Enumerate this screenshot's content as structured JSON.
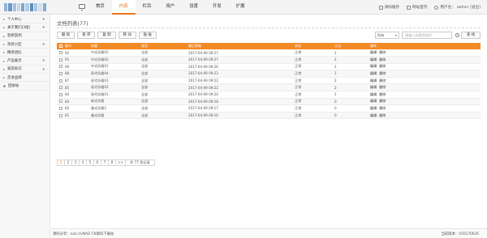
{
  "logo": {
    "colors": [
      "#8fb4d8",
      "#6b97c4",
      "#9fc1de",
      "#c6d8ea",
      "#7da6ce",
      "#b2cde5",
      "#5e8bba",
      "#a7c5e1",
      "#d0e1ef",
      "#84abd1"
    ]
  },
  "nav": {
    "items": [
      {
        "label": "首页",
        "active": false
      },
      {
        "label": "内容",
        "active": true
      },
      {
        "label": "栏目",
        "active": false
      },
      {
        "label": "用户",
        "active": false
      },
      {
        "label": "设置",
        "active": false
      },
      {
        "label": "开发",
        "active": false
      },
      {
        "label": "扩展",
        "active": false
      }
    ]
  },
  "toplinks": {
    "cache": "清除缓存",
    "home": "网站首页",
    "user_prefix": "用户名：",
    "username": "admin",
    "logout": "[退出]"
  },
  "sidebar": {
    "items": [
      {
        "label": "个人中心",
        "plus": true
      },
      {
        "label": "关于我们(3组)",
        "plus": true
      },
      {
        "label": "装修案例",
        "plus": false
      },
      {
        "label": "热装小区",
        "plus": true
      },
      {
        "label": "精英团队",
        "plus": false
      },
      {
        "label": "产品展示",
        "plus": true
      },
      {
        "label": "家装知识",
        "plus": true
      },
      {
        "label": "走进品牌",
        "plus": false
      },
      {
        "label": "回收站",
        "plus": false,
        "dot": true
      }
    ]
  },
  "page": {
    "title": "文档列表(77)"
  },
  "toolbar": {
    "buttons": [
      "删 除",
      "排 序",
      "复 制",
      "移 动",
      "粘 贴"
    ]
  },
  "filter": {
    "select": "所有",
    "placeholder": "请输入标题关键字",
    "search_label": "查 找"
  },
  "table": {
    "headers": [
      "",
      "编号",
      "标题",
      "类型",
      "最后更新",
      "状态",
      "点击",
      "操作"
    ],
    "rows": [
      {
        "id": "92",
        "title": "中式风格03",
        "type": "全部",
        "updated": "2017-04-09 09:27",
        "status": "正常",
        "clicks": "1"
      },
      {
        "id": "91",
        "title": "中式风格02",
        "type": "全部",
        "updated": "2017-04-09 09:27",
        "status": "正常",
        "clicks": "2"
      },
      {
        "id": "90",
        "title": "中式风格01",
        "type": "全部",
        "updated": "2017-04-09 09:26",
        "status": "正常",
        "clicks": "1"
      },
      {
        "id": "88",
        "title": "现代风格04",
        "type": "全部",
        "updated": "2017-04-09 09:23",
        "status": "正常",
        "clicks": "1"
      },
      {
        "id": "87",
        "title": "现代风格03",
        "type": "全部",
        "updated": "2017-04-09 09:22",
        "status": "正常",
        "clicks": "2"
      },
      {
        "id": "85",
        "title": "现代风格02",
        "type": "全部",
        "updated": "2017-04-09 09:22",
        "status": "正常",
        "clicks": "2"
      },
      {
        "id": "84",
        "title": "现代风格01",
        "type": "全部",
        "updated": "2017-04-09 09:20",
        "status": "正常",
        "clicks": "1"
      },
      {
        "id": "83",
        "title": "新式风格",
        "type": "全部",
        "updated": "2017-04-09 09:18",
        "status": "正常",
        "clicks": "0"
      },
      {
        "id": "82",
        "title": "美式风格2",
        "type": "全部",
        "updated": "2017-04-09 09:17",
        "status": "正常",
        "clicks": "0"
      },
      {
        "id": "81",
        "title": "美式风格",
        "type": "全部",
        "updated": "2017-04-09 09:16",
        "status": "正常",
        "clicks": "0"
      }
    ],
    "actions": [
      "编辑",
      "删除"
    ]
  },
  "pager": {
    "pages": [
      "1",
      "2",
      "3",
      "4",
      "5",
      "6",
      "7",
      "8"
    ],
    "next": ">>",
    "info": "共 77 条记录"
  },
  "footer": {
    "left": "源码分享：naz.cn/NAZ.CN源码下载站",
    "right": "当前版本：V20170626"
  },
  "colors": {
    "accent": "#e8761c",
    "table_head": "#f28a25"
  }
}
